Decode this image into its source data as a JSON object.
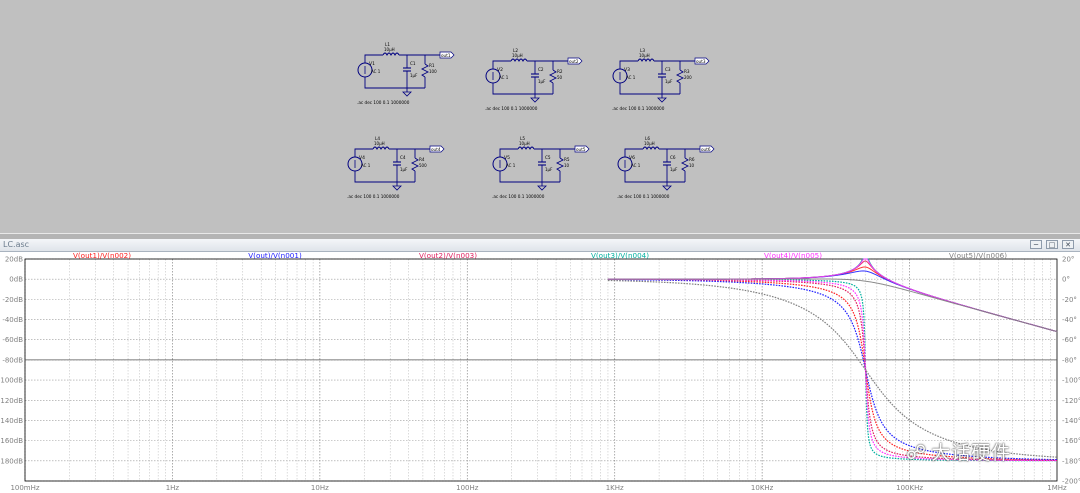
{
  "window": {
    "title": "LC.asc",
    "min_glyph": "─",
    "restore_glyph": "□",
    "close_glyph": "✕"
  },
  "schematic": {
    "blocks": [
      {
        "source": "V1",
        "source_val": "AC 1",
        "inductor": "L1",
        "inductor_val": "10μH",
        "cap": "C1",
        "cap_val": "1μF",
        "res": "R1",
        "res_val": "100",
        "net": "out1",
        "directive": ".ac dec 100 0.1 1000000"
      },
      {
        "source": "V2",
        "source_val": "AC 1",
        "inductor": "L2",
        "inductor_val": "10μH",
        "cap": "C2",
        "cap_val": "1μF",
        "res": "R2",
        "res_val": "50",
        "net": "out2",
        "directive": ".ac dec 100 0.1 1000000"
      },
      {
        "source": "V3",
        "source_val": "AC 1",
        "inductor": "L3",
        "inductor_val": "10μH",
        "cap": "C3",
        "cap_val": "1μF",
        "res": "R3",
        "res_val": "200",
        "net": "out3",
        "directive": ".ac dec 100 0.1 1000000"
      },
      {
        "source": "V4",
        "source_val": "AC 1",
        "inductor": "L4",
        "inductor_val": "10μH",
        "cap": "C4",
        "cap_val": "1μF",
        "res": "R4",
        "res_val": "500",
        "net": "out4",
        "directive": ".ac dec 100 0.1 1000000"
      },
      {
        "source": "V5",
        "source_val": "AC 1",
        "inductor": "L5",
        "inductor_val": "10μH",
        "cap": "C5",
        "cap_val": "1μF",
        "res": "R5",
        "res_val": "10",
        "net": "out5",
        "directive": ".ac dec 100 0.1 1000000"
      },
      {
        "source": "V6",
        "source_val": "AC 1",
        "inductor": "L6",
        "inductor_val": "10μH",
        "cap": "C6",
        "cap_val": "1μF",
        "res": "R6",
        "res_val": "10",
        "net": "out6",
        "directive": ".ac dec 100 0.1 1000000"
      }
    ]
  },
  "chart_data": {
    "type": "line",
    "x_scale": "log",
    "xlim": [
      0.1,
      1000000
    ],
    "x_ticks": [
      "100mHz",
      "1Hz",
      "10Hz",
      "100Hz",
      "1KHz",
      "10KHz",
      "100KHz",
      "1MHz"
    ],
    "left_ticks": [
      "20dB",
      "0dB",
      "-20dB",
      "-40dB",
      "-60dB",
      "-80dB",
      "-100dB",
      "-120dB",
      "-140dB",
      "-160dB",
      "-180dB"
    ],
    "right_ticks": [
      "20°",
      "0°",
      "-20°",
      "-40°",
      "-60°",
      "-80°",
      "-100°",
      "-120°",
      "-140°",
      "-160°",
      "-180°",
      "-200°"
    ],
    "ylim_phase": [
      -200,
      20
    ],
    "grid": true,
    "series": [
      {
        "name": "V(out1)/V(n002)",
        "color": "#ff2020"
      },
      {
        "name": "V(out)/V(n001)",
        "color": "#2020ff"
      },
      {
        "name": "V(out2)/V(n003)",
        "color": "#e02060"
      },
      {
        "name": "V(out3)/V(n004)",
        "color": "#00b0a0"
      },
      {
        "name": "V(out4)/V(n005)",
        "color": "#ff30ff"
      },
      {
        "name": "V(out5)/V(n006)",
        "color": "#808080"
      }
    ],
    "resonance_hz": 50300,
    "mag_peak_db": [
      12,
      8,
      18,
      28,
      22,
      -2
    ]
  },
  "watermark": {
    "text": "大话硬件",
    "icon": "wechat-icon"
  }
}
